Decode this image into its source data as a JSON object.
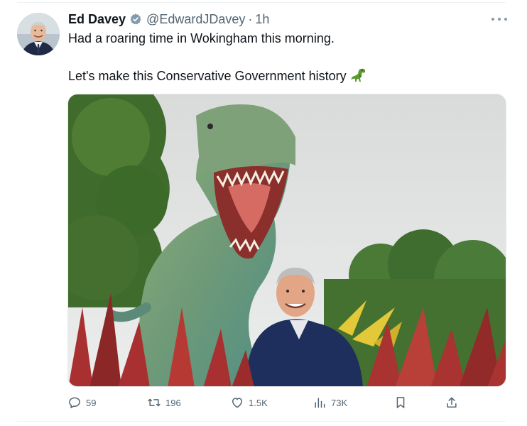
{
  "tweet": {
    "author": {
      "name": "Ed Davey",
      "handle": "@EdwardJDavey",
      "separator": "·",
      "time": "1h",
      "verified": true,
      "avatar_icon": "profile-photo"
    },
    "text": {
      "line1": "Had a roaring time in Wokingham this morning.",
      "line2": "Let's make this Conservative Government history",
      "emoji": "t-rex-emoji"
    },
    "media": {
      "type": "photo",
      "content": "man-smiling-in-front-of-t-rex-model"
    },
    "actions": {
      "replies": "59",
      "retweets": "196",
      "likes": "1.5K",
      "views": "73K"
    }
  },
  "colors": {
    "text": "#0f1419",
    "muted": "#536471",
    "verified": "#829aab",
    "divider": "#eff3f4"
  }
}
